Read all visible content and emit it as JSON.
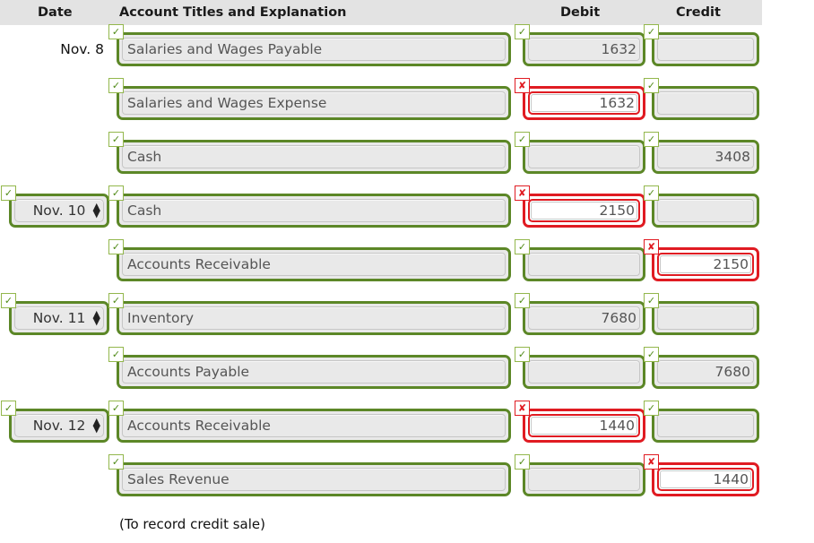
{
  "header": {
    "date": "Date",
    "account": "Account Titles and Explanation",
    "debit": "Debit",
    "credit": "Credit"
  },
  "icons": {
    "check": "✓",
    "cross": "✘",
    "arrow_up": "▲",
    "arrow_down": "▼"
  },
  "colors": {
    "ok_border": "#5c8727",
    "err_border": "#e01b22",
    "field_bg": "#e9e9e9",
    "header_bg": "#e3e3e3",
    "text": "#555555"
  },
  "rows": [
    {
      "date_type": "static",
      "date": "Nov. 8",
      "date_status": "none",
      "account": "Salaries and Wages Payable",
      "account_indent": false,
      "account_status": "ok",
      "debit": "1632",
      "debit_status": "ok",
      "credit": "",
      "credit_status": "ok"
    },
    {
      "date_type": "none",
      "date": "",
      "date_status": "none",
      "account": "Salaries and Wages Expense",
      "account_indent": false,
      "account_status": "ok",
      "debit": "1632",
      "debit_status": "err",
      "credit": "",
      "credit_status": "ok"
    },
    {
      "date_type": "none",
      "date": "",
      "date_status": "none",
      "account": "Cash",
      "account_indent": true,
      "account_status": "ok",
      "debit": "",
      "debit_status": "ok",
      "credit": "3408",
      "credit_status": "ok"
    },
    {
      "date_type": "select",
      "date": "Nov. 10",
      "date_status": "ok",
      "account": "Cash",
      "account_indent": false,
      "account_status": "ok",
      "debit": "2150",
      "debit_status": "err",
      "credit": "",
      "credit_status": "ok"
    },
    {
      "date_type": "none",
      "date": "",
      "date_status": "none",
      "account": "Accounts Receivable",
      "account_indent": true,
      "account_status": "ok",
      "debit": "",
      "debit_status": "ok",
      "credit": "2150",
      "credit_status": "err"
    },
    {
      "date_type": "select",
      "date": "Nov. 11",
      "date_status": "ok",
      "account": "Inventory",
      "account_indent": false,
      "account_status": "ok",
      "debit": "7680",
      "debit_status": "ok",
      "credit": "",
      "credit_status": "ok"
    },
    {
      "date_type": "none",
      "date": "",
      "date_status": "none",
      "account": "Accounts Payable",
      "account_indent": true,
      "account_status": "ok",
      "debit": "",
      "debit_status": "ok",
      "credit": "7680",
      "credit_status": "ok"
    },
    {
      "date_type": "select",
      "date": "Nov. 12",
      "date_status": "ok",
      "account": "Accounts Receivable",
      "account_indent": false,
      "account_status": "ok",
      "debit": "1440",
      "debit_status": "err",
      "credit": "",
      "credit_status": "ok"
    },
    {
      "date_type": "none",
      "date": "",
      "date_status": "none",
      "account": "Sales Revenue",
      "account_indent": true,
      "account_status": "ok",
      "debit": "",
      "debit_status": "ok",
      "credit": "1440",
      "credit_status": "err"
    }
  ],
  "memo": "(To record credit sale)"
}
